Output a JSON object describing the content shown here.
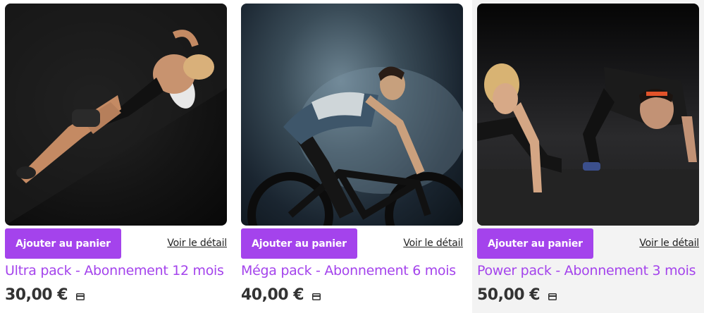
{
  "products": [
    {
      "image_alt": "Femme allongée au sol",
      "cart_button_label": "Ajouter au panier",
      "detail_link_label": "Voir le détail",
      "title": "Ultra pack - Abonnement 12 mois",
      "price": "30,00 €",
      "price_icon": "credit-card-icon"
    },
    {
      "image_alt": "Cycliste sur vélo",
      "cart_button_label": "Ajouter au panier",
      "detail_link_label": "Voir le détail",
      "title": "Méga pack - Abonnement 6 mois",
      "price": "40,00 €",
      "price_icon": "credit-card-icon"
    },
    {
      "image_alt": "Deux personnes faisant des pompes",
      "cart_button_label": "Ajouter au panier",
      "detail_link_label": "Voir le détail",
      "title": "Power pack - Abonnement 3 mois",
      "price": "50,00 €",
      "price_icon": "credit-card-icon"
    }
  ],
  "colors": {
    "accent": "#a443ec",
    "price_text": "#333333",
    "link_text": "#222222"
  }
}
